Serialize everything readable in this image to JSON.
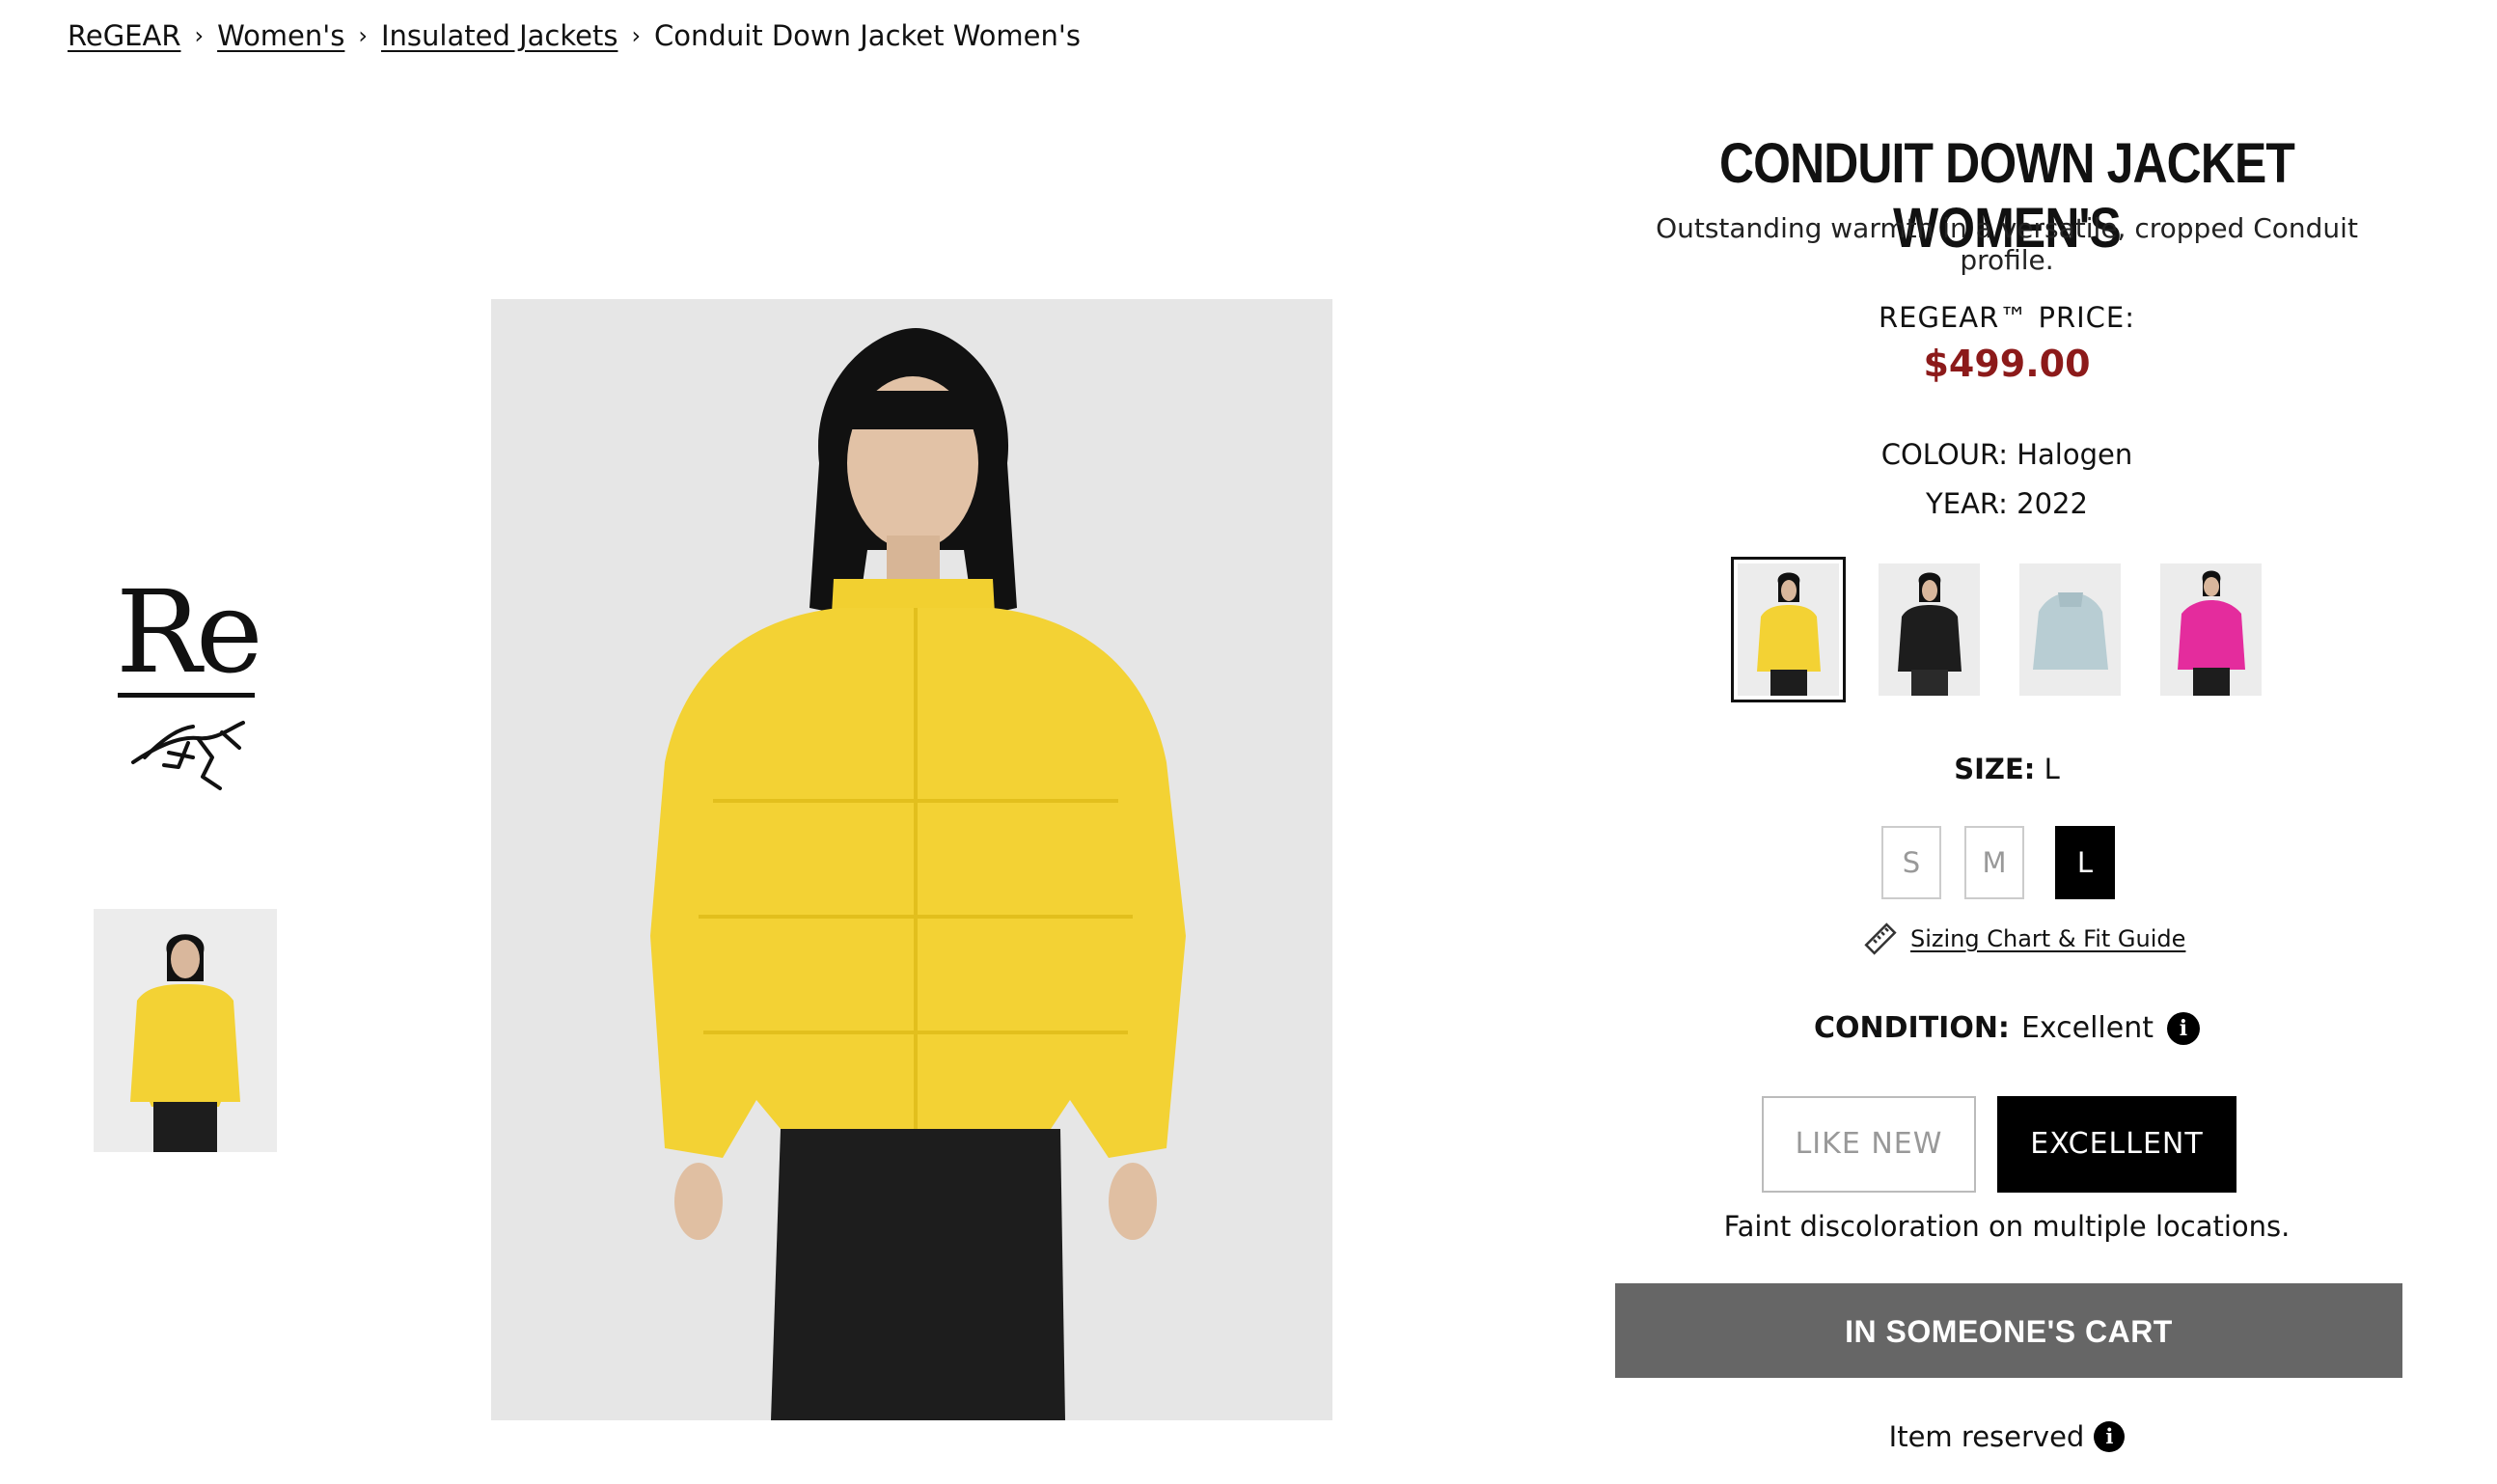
{
  "breadcrumb": {
    "items": [
      "ReGEAR",
      "Women's",
      "Insulated Jackets"
    ],
    "current": "Conduit Down Jacket Women's",
    "separator": "›"
  },
  "left_thumbs": {
    "logo_text": "Re"
  },
  "product": {
    "title": "CONDUIT DOWN JACKET WOMEN'S",
    "subtitle": "Outstanding warmth in a versatile, cropped Conduit profile.",
    "price_label": "REGEAR™ PRICE:",
    "price": "$499.00",
    "colour_text": "COLOUR: Halogen",
    "year_text": "YEAR: 2022",
    "swatches": [
      {
        "name": "Halogen",
        "color": "#f3d234",
        "selected": true
      },
      {
        "name": "Black",
        "color": "#1d1d1d",
        "selected": false
      },
      {
        "name": "Light blue",
        "color": "#b8cdd3",
        "selected": false
      },
      {
        "name": "Pink",
        "color": "#e42c9d",
        "selected": false
      }
    ],
    "size_label": "SIZE:",
    "size_value": "L",
    "sizes": [
      "S",
      "M",
      "L"
    ],
    "sizing_link": "Sizing Chart & Fit Guide",
    "condition_label": "CONDITION:",
    "condition_value": "Excellent",
    "condition_options": [
      "LIKE NEW",
      "EXCELLENT"
    ],
    "condition_desc": "Faint discoloration on multiple locations.",
    "cart_button": "IN SOMEONE'S CART",
    "reserved_text": "Item reserved",
    "info_glyph": "i"
  },
  "colors": {
    "price_red": "#8c1a1a",
    "cart_bg": "#666666"
  }
}
